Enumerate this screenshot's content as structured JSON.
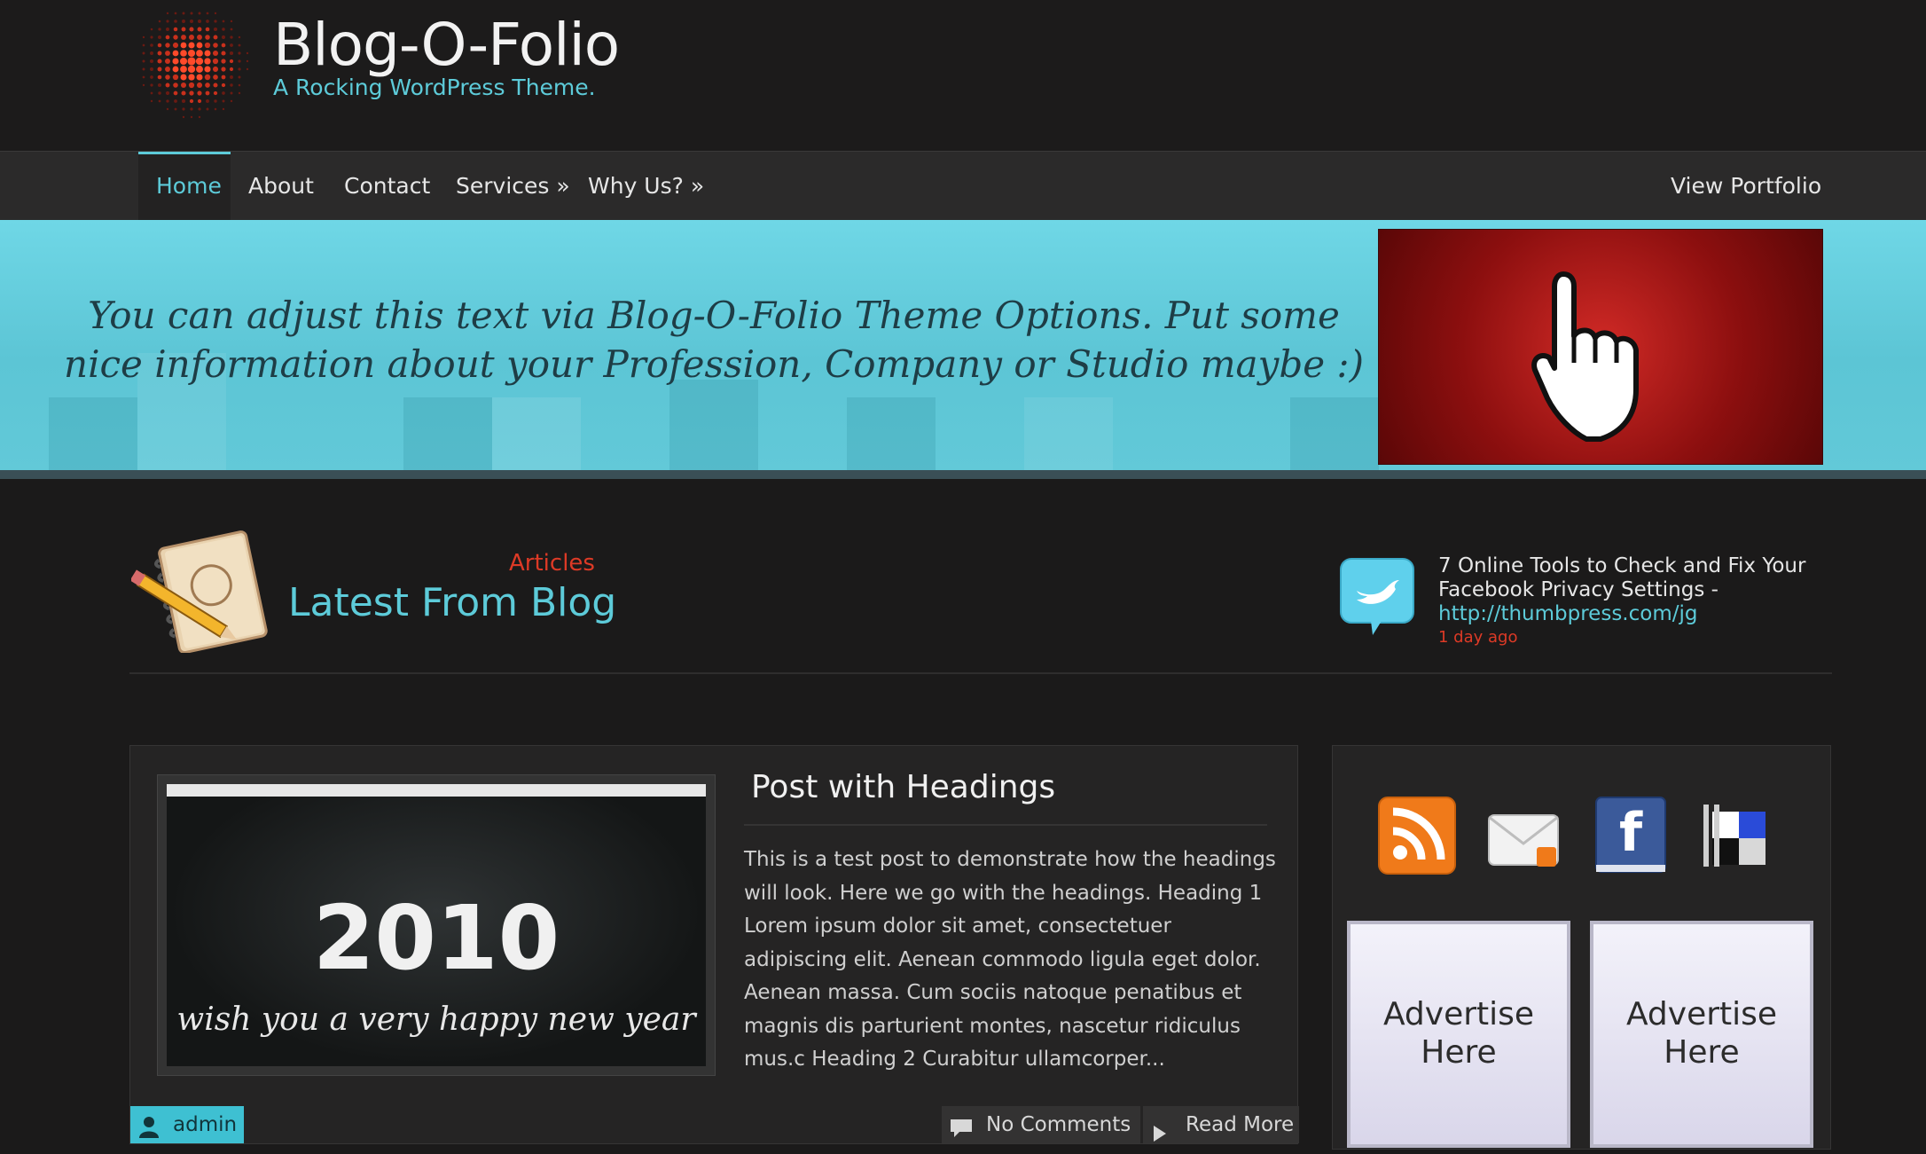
{
  "header": {
    "site_title": "Blog-O-Folio",
    "tagline": "A Rocking WordPress Theme."
  },
  "nav": {
    "items": [
      {
        "label": "Home"
      },
      {
        "label": "About"
      },
      {
        "label": "Contact"
      },
      {
        "label": "Services »"
      },
      {
        "label": "Why Us? »"
      }
    ],
    "right_link": "View Portfolio"
  },
  "hero": {
    "text": "You can adjust this text via Blog-O-Folio Theme Options. Put some nice information about your Profession, Company or Studio maybe :)"
  },
  "blog_section": {
    "kicker": "Articles",
    "title": "Latest From Blog"
  },
  "tweet": {
    "text": "7 Online Tools to Check and Fix Your Facebook Privacy Settings -",
    "link": "http://thumbpress.com/jg",
    "time": "1 day ago"
  },
  "post": {
    "title": "Post with Headings",
    "excerpt": "This is a test post to demonstrate how the headings will look. Here we go with the headings. Heading 1 Lorem ipsum dolor sit amet, consectetuer adipiscing elit. Aenean commodo ligula eget dolor. Aenean massa. Cum sociis natoque penatibus et magnis dis parturient montes, nascetur ridiculus mus.c Heading 2 Curabitur ullamcorper...",
    "thumbnail": {
      "year": "2010",
      "wish": "wish you a very happy new year"
    },
    "author": "admin",
    "comments": "No Comments",
    "read_more": "Read More"
  },
  "sidebar": {
    "social_icons": [
      "rss-icon",
      "email-subscribe-icon",
      "facebook-icon",
      "delicious-icon"
    ],
    "ads": [
      {
        "label": "Advertise Here"
      },
      {
        "label": "Advertise Here"
      }
    ]
  },
  "colors": {
    "accent": "#5dcbd9",
    "highlight": "#dd3a26",
    "background": "#1b1a1a"
  }
}
